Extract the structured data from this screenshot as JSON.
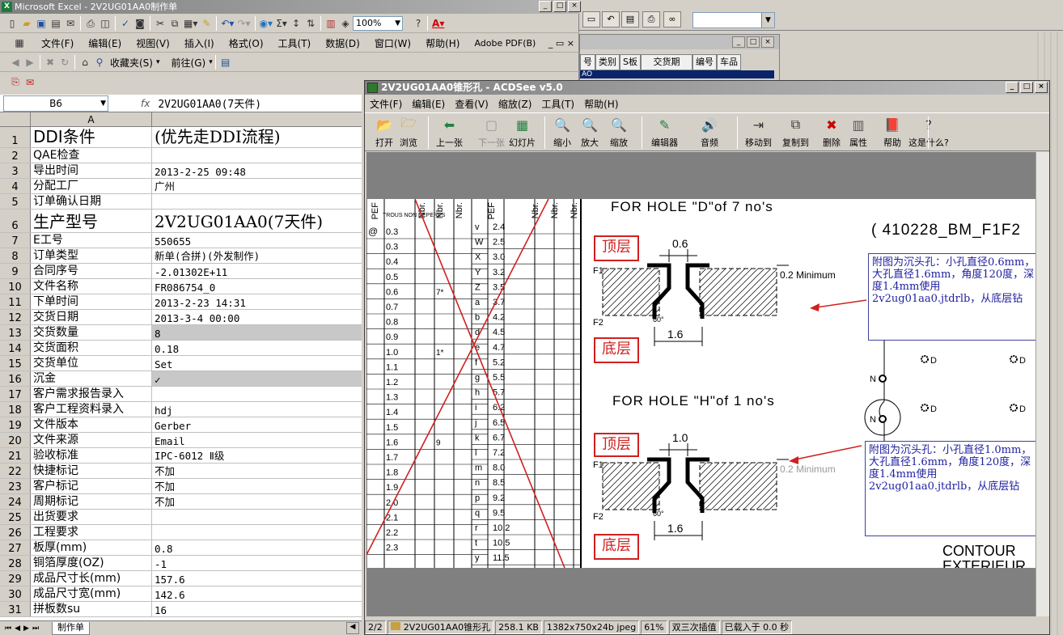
{
  "bg_app": {
    "columns": [
      "号",
      "类别",
      "S板",
      "交货期",
      "编号",
      "车品"
    ],
    "row_val": "AO"
  },
  "excel": {
    "title": "Microsoft Excel - 2V2UG01AA0制作单",
    "menu": [
      "文件(F)",
      "编辑(E)",
      "视图(V)",
      "插入(I)",
      "格式(O)",
      "工具(T)",
      "数据(D)",
      "窗口(W)",
      "帮助(H)",
      "Adobe PDF(B)"
    ],
    "toolbar3": [
      "收藏夹(S)",
      "前往(G)"
    ],
    "zoom": "100%",
    "namebox": "B6",
    "fx": "fx",
    "formula": "2V2UG01AA0(7天件)",
    "col_header": "A",
    "rows": [
      {
        "n": "1",
        "a": "DDI条件",
        "b": "(优先走DDI流程)"
      },
      {
        "n": "2",
        "a": "QAE检查",
        "b": ""
      },
      {
        "n": "3",
        "a": "导出时间",
        "b": "2013-2-25 09:48"
      },
      {
        "n": "4",
        "a": "分配工厂",
        "b": "广州"
      },
      {
        "n": "5",
        "a": "订单确认日期",
        "b": ""
      },
      {
        "n": "6",
        "a": "生产型号",
        "b": "2V2UG01AA0(7天件)"
      },
      {
        "n": "7",
        "a": "E工号",
        "b": "550655"
      },
      {
        "n": "8",
        "a": "订单类型",
        "b": "新单(合拼)(外发制作)"
      },
      {
        "n": "9",
        "a": "合同序号",
        "b": "-2.01302E+11"
      },
      {
        "n": "10",
        "a": "文件名称",
        "b": "FR086754_0"
      },
      {
        "n": "11",
        "a": "下单时间",
        "b": "2013-2-23 14:31"
      },
      {
        "n": "12",
        "a": "交货日期",
        "b": "2013-3-4 00:00"
      },
      {
        "n": "13",
        "a": "交货数量",
        "b": "8"
      },
      {
        "n": "14",
        "a": "交货面积",
        "b": "0.18"
      },
      {
        "n": "15",
        "a": "交货单位",
        "b": "Set"
      },
      {
        "n": "16",
        "a": "沉金",
        "b": "✓"
      },
      {
        "n": "17",
        "a": "客户需求报告录入",
        "b": ""
      },
      {
        "n": "18",
        "a": "客户工程资料录入",
        "b": "hdj"
      },
      {
        "n": "19",
        "a": "文件版本",
        "b": "Gerber"
      },
      {
        "n": "20",
        "a": "文件来源",
        "b": "Email"
      },
      {
        "n": "21",
        "a": "验收标准",
        "b": "IPC-6012 Ⅱ级"
      },
      {
        "n": "22",
        "a": "快捷标记",
        "b": "不加"
      },
      {
        "n": "23",
        "a": "客户标记",
        "b": "不加"
      },
      {
        "n": "24",
        "a": "周期标记",
        "b": "不加"
      },
      {
        "n": "25",
        "a": "出货要求",
        "b": ""
      },
      {
        "n": "26",
        "a": "工程要求",
        "b": ""
      },
      {
        "n": "27",
        "a": "板厚(mm)",
        "b": "0.8"
      },
      {
        "n": "28",
        "a": "铜箔厚度(OZ)",
        "b": "-1"
      },
      {
        "n": "29",
        "a": "成品尺寸长(mm)",
        "b": "157.6"
      },
      {
        "n": "30",
        "a": "成品尺寸宽(mm)",
        "b": "142.6"
      },
      {
        "n": "31",
        "a": "拼板数su",
        "b": "16"
      }
    ],
    "sheet_tab": "制作单"
  },
  "acdsee": {
    "title": "2V2UG01AA0锥形孔 - ACDSee v5.0",
    "menu": [
      "文件(F)",
      "编辑(E)",
      "查看(V)",
      "缩放(Z)",
      "工具(T)",
      "帮助(H)"
    ],
    "toolbar": [
      {
        "label": "打开",
        "icon": "open-folder-icon"
      },
      {
        "label": "浏览",
        "icon": "browse-icon"
      },
      {
        "label": "上一张",
        "icon": "prev-arrow-icon"
      },
      {
        "label": "下一张",
        "icon": "next-arrow-icon"
      },
      {
        "label": "幻灯片",
        "icon": "slideshow-icon"
      },
      {
        "label": "缩小",
        "icon": "zoom-out-icon"
      },
      {
        "label": "放大",
        "icon": "zoom-in-icon"
      },
      {
        "label": "缩放",
        "icon": "zoom-icon"
      },
      {
        "label": "编辑器",
        "icon": "editor-wand-icon"
      },
      {
        "label": "音频",
        "icon": "speaker-icon"
      },
      {
        "label": "移动到",
        "icon": "move-to-icon"
      },
      {
        "label": "复制到",
        "icon": "copy-to-icon"
      },
      {
        "label": "删除",
        "icon": "delete-x-icon"
      },
      {
        "label": "属性",
        "icon": "properties-icon"
      },
      {
        "label": "帮助",
        "icon": "help-book-icon"
      },
      {
        "label": "这是什么?",
        "icon": "whats-this-icon"
      }
    ],
    "status": [
      "2/2",
      "2V2UG01AA0锥形孔",
      "258.1 KB",
      "1382x750x24b jpeg",
      "61%",
      "双三次插值",
      "已载入于 0.0 秒"
    ],
    "image": {
      "table_headers": [
        "PEF",
        "Nbr.",
        "Nbr.",
        "Nbr.",
        "PEF",
        "Nbr.",
        "Nbr.",
        "Nbr."
      ],
      "table_caption": "TROUS NON REPERES",
      "left_rows": [
        {
          "k": "@",
          "v": "0.3",
          "c": ""
        },
        {
          "k": "",
          "v": "0.3",
          "c": ""
        },
        {
          "k": "",
          "v": "0.4",
          "c": ""
        },
        {
          "k": "",
          "v": "0.5",
          "c": ""
        },
        {
          "k": "",
          "v": "0.6",
          "c": "7*"
        },
        {
          "k": "",
          "v": "0.7",
          "c": ""
        },
        {
          "k": "",
          "v": "0.8",
          "c": ""
        },
        {
          "k": "",
          "v": "0.9",
          "c": ""
        },
        {
          "k": "",
          "v": "1.0",
          "c": "1*"
        },
        {
          "k": "",
          "v": "1.1",
          "c": ""
        },
        {
          "k": "",
          "v": "1.2",
          "c": ""
        },
        {
          "k": "",
          "v": "1.3",
          "c": ""
        },
        {
          "k": "",
          "v": "1.4",
          "c": ""
        },
        {
          "k": "",
          "v": "1.5",
          "c": ""
        },
        {
          "k": "",
          "v": "1.6",
          "c": "9"
        },
        {
          "k": "",
          "v": "1.7",
          "c": ""
        },
        {
          "k": "",
          "v": "1.8",
          "c": ""
        },
        {
          "k": "",
          "v": "1.9",
          "c": ""
        },
        {
          "k": "",
          "v": "2.0",
          "c": ""
        },
        {
          "k": "",
          "v": "2.1",
          "c": ""
        },
        {
          "k": "",
          "v": "2.2",
          "c": ""
        },
        {
          "k": "",
          "v": "2.3",
          "c": ""
        }
      ],
      "right_rows": [
        {
          "k": "v",
          "v": "2.4"
        },
        {
          "k": "W",
          "v": "2.5"
        },
        {
          "k": "X",
          "v": "3.0"
        },
        {
          "k": "Y",
          "v": "3.2"
        },
        {
          "k": "Z",
          "v": "3.5"
        },
        {
          "k": "a",
          "v": "3.7"
        },
        {
          "k": "b",
          "v": "4.2"
        },
        {
          "k": "d",
          "v": "4.5"
        },
        {
          "k": "e",
          "v": "4.7"
        },
        {
          "k": "f",
          "v": "5.2"
        },
        {
          "k": "g",
          "v": "5.5"
        },
        {
          "k": "h",
          "v": "5.7"
        },
        {
          "k": "i",
          "v": "6.2"
        },
        {
          "k": "j",
          "v": "6.5"
        },
        {
          "k": "k",
          "v": "6.7"
        },
        {
          "k": "l",
          "v": "7.2"
        },
        {
          "k": "m",
          "v": "8.0"
        },
        {
          "k": "n",
          "v": "8.5"
        },
        {
          "k": "p",
          "v": "9.2"
        },
        {
          "k": "q",
          "v": "9.5"
        },
        {
          "k": "r",
          "v": "10.2"
        },
        {
          "k": "t",
          "v": "10.5"
        },
        {
          "k": "y",
          "v": "11.5"
        }
      ],
      "hole_d_title": "FOR HOLE \"D\"of 7 no's",
      "hole_h_title": "FOR HOLE \"H\"of 1 no's",
      "part_no": "( 410228_BM_F1F2",
      "top_layer": "顶层",
      "bottom_layer": "底层",
      "dim_d_top": "0.6",
      "dim_d_bottom": "1.6",
      "dim_h_top": "1.0",
      "dim_h_bottom": "1.6",
      "min_label": "0.2 Minimum",
      "angle": "60°",
      "f1": "F1",
      "f2": "F2",
      "note1": "附图为沉头孔：小孔直径0.6mm，大孔直径1.6mm，角度120度，深度1.4mm使用2v2ug01aa0.jtdrlb，从底层钻",
      "note2": "附图为沉头孔：小孔直径1.0mm，大孔直径1.6mm，角度120度，深度1.4mm使用2v2ug01aa0.jtdrlb，从底层钻",
      "contour_1": "CONTOUR",
      "contour_2": "EXTERIEUR",
      "marker_d": "D",
      "marker_n": "N"
    }
  }
}
